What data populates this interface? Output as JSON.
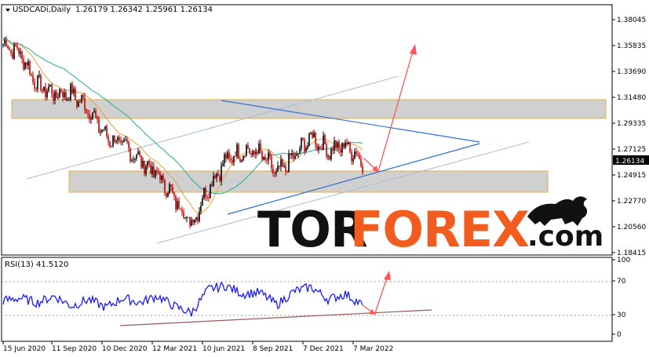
{
  "header": {
    "symbol": "USDCADi,Daily",
    "ohlc": "1.26179 1.26342 1.25961 1.26134"
  },
  "rsi": {
    "label": "RSI(13) 41.5120",
    "ticks": [
      "100",
      "70",
      "30",
      "0"
    ]
  },
  "price_axis": {
    "ticks": [
      "1.38045",
      "1.35835",
      "1.33690",
      "1.31480",
      "1.29335",
      "1.27125",
      "1.24915",
      "1.22770",
      "1.20560",
      "1.18415"
    ],
    "current": "1.26134"
  },
  "time_axis": {
    "ticks": [
      "15 Jun 2020",
      "11 Sep 2020",
      "10 Dec 2020",
      "12 Mar 2021",
      "10 Jun 2021",
      "8 Sep 2021",
      "7 Dec 2021",
      "7 Mar 2022"
    ]
  },
  "watermark": {
    "part1": "TOR",
    "part2": "FOREX",
    "part3": ".com"
  },
  "colors": {
    "bull": "#000000",
    "bear": "#cc0000",
    "ma_fast": "#e8a13a",
    "ma_slow": "#2aa89a",
    "rsi_line": "#1a1aff",
    "trend_blue": "#2f6fd6",
    "arrow": "#ff5555",
    "zone_border": "#e0b040",
    "zone_fill": "#d0d0d0"
  },
  "chart_data": [
    {
      "type": "candlestick",
      "title": "USDCADi,Daily",
      "x_range": [
        "2020-06-15",
        "2022-03-15"
      ],
      "ylim": [
        1.18415,
        1.38045
      ],
      "series": [
        {
          "name": "",
          "x": [
            "2020-06-15",
            "2020-07-15",
            "2020-08-15",
            "2020-09-15",
            "2020-10-15",
            "2020-11-15",
            "2020-12-15",
            "2021-01-15",
            "2021-02-15",
            "2021-03-15",
            "2021-04-15",
            "2021-05-15",
            "2021-06-15",
            "2021-07-15",
            "2021-08-15",
            "2021-09-15",
            "2021-10-15",
            "2021-11-15",
            "2021-12-15",
            "2022-01-15",
            "2022-02-15",
            "2022-03-10"
          ],
          "values": [
            1.36,
            1.352,
            1.325,
            1.318,
            1.318,
            1.305,
            1.282,
            1.275,
            1.262,
            1.25,
            1.23,
            1.208,
            1.24,
            1.262,
            1.27,
            1.268,
            1.25,
            1.265,
            1.282,
            1.27,
            1.275,
            1.261
          ]
        }
      ],
      "zones": [
        [
          1.3,
          1.311
        ],
        [
          1.247,
          1.259
        ]
      ]
    },
    {
      "type": "line",
      "title": "RSI(13) 41.5120",
      "ylim": [
        0,
        100
      ],
      "levels": [
        30,
        70
      ],
      "series": [
        {
          "name": "",
          "x": [
            "2020-06-15",
            "2020-07-15",
            "2020-08-15",
            "2020-09-15",
            "2020-10-15",
            "2020-11-15",
            "2020-12-15",
            "2021-01-15",
            "2021-02-15",
            "2021-03-15",
            "2021-04-15",
            "2021-05-15",
            "2021-06-15",
            "2021-07-15",
            "2021-08-15",
            "2021-09-15",
            "2021-10-15",
            "2021-11-15",
            "2021-12-15",
            "2022-01-15",
            "2022-02-15",
            "2022-03-10"
          ],
          "values": [
            48,
            52,
            45,
            55,
            40,
            50,
            38,
            52,
            45,
            55,
            40,
            30,
            65,
            70,
            58,
            60,
            42,
            62,
            68,
            50,
            58,
            41.5
          ]
        }
      ]
    }
  ]
}
